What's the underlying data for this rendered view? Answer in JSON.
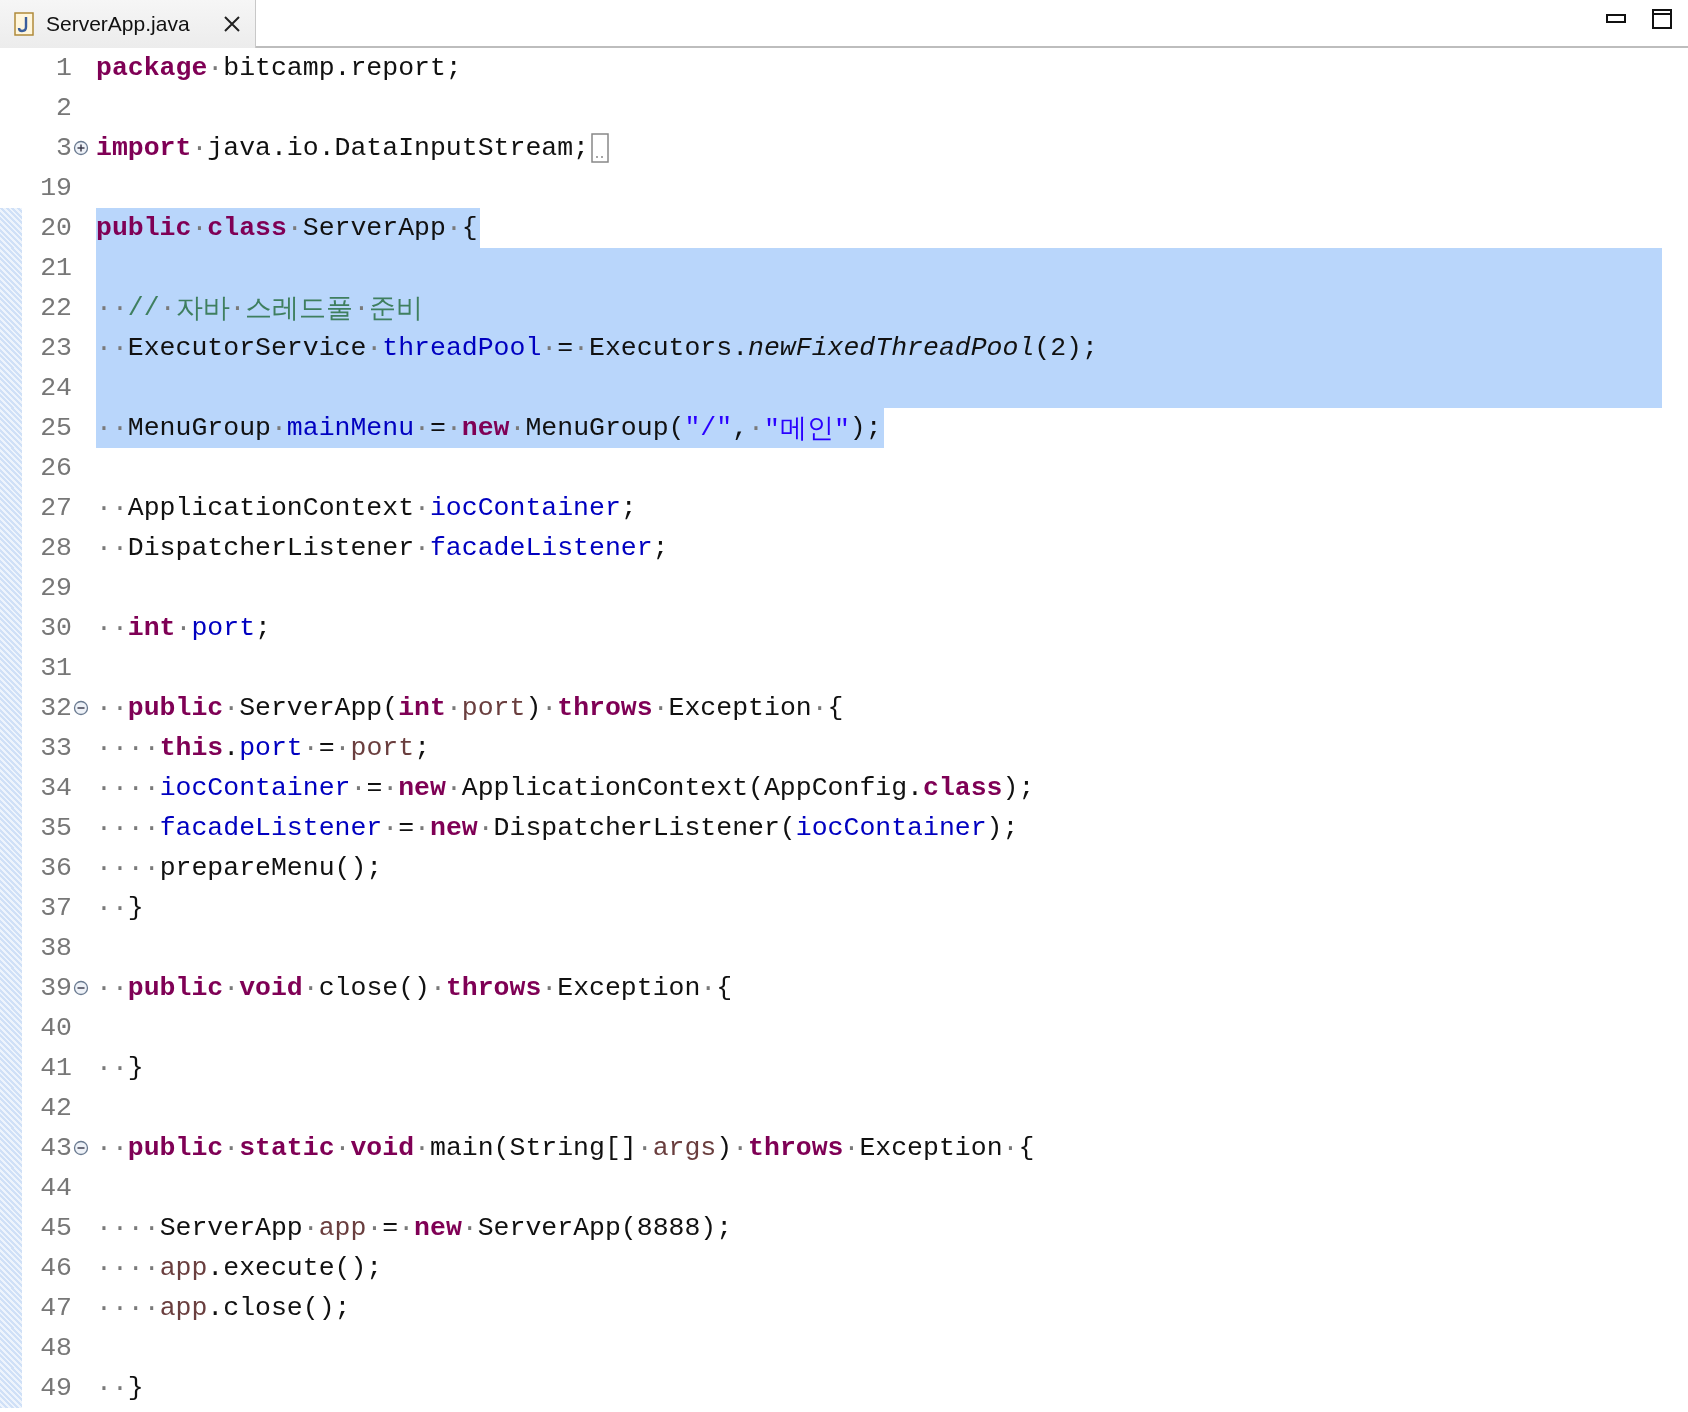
{
  "editor_tab": {
    "title": "ServerApp.java",
    "selected": true
  },
  "lines": [
    {
      "number": "1",
      "in_range": false,
      "tokens": [
        {
          "kind": "keyword",
          "text": "package"
        },
        {
          "kind": "space",
          "text": "·"
        },
        {
          "kind": "plain",
          "text": "bitcamp.report;"
        }
      ]
    },
    {
      "number": "2",
      "in_range": false
    },
    {
      "number": "3",
      "in_range": false,
      "collapsed": true,
      "tokens": [
        {
          "kind": "keyword",
          "text": "import"
        },
        {
          "kind": "space",
          "text": "·"
        },
        {
          "kind": "plain",
          "text": "java.io.DataInputStream;"
        }
      ]
    },
    {
      "number": "19",
      "in_range": false
    },
    {
      "number": "20",
      "in_range": true,
      "selected": true,
      "full_width": false,
      "tokens": [
        {
          "kind": "keyword",
          "text": "public"
        },
        {
          "kind": "space",
          "text": "·"
        },
        {
          "kind": "keyword",
          "text": "class"
        },
        {
          "kind": "space",
          "text": "·"
        },
        {
          "kind": "plain",
          "text": "ServerApp"
        },
        {
          "kind": "space",
          "text": "·"
        },
        {
          "kind": "plain",
          "text": "{"
        }
      ]
    },
    {
      "number": "21",
      "in_range": true,
      "selected": true,
      "full_width": true
    },
    {
      "number": "22",
      "in_range": true,
      "selected": true,
      "full_width": true,
      "tokens": [
        {
          "kind": "space",
          "text": "··"
        },
        {
          "kind": "comment",
          "text": "//"
        },
        {
          "kind": "space",
          "text": "·"
        },
        {
          "kind": "comment",
          "text": "자바"
        },
        {
          "kind": "space",
          "text": "·"
        },
        {
          "kind": "comment",
          "text": "스레드풀"
        },
        {
          "kind": "space",
          "text": "·"
        },
        {
          "kind": "comment",
          "text": "준비"
        }
      ]
    },
    {
      "number": "23",
      "in_range": true,
      "selected": true,
      "full_width": true,
      "tokens": [
        {
          "kind": "space",
          "text": "··"
        },
        {
          "kind": "plain",
          "text": "ExecutorService"
        },
        {
          "kind": "space",
          "text": "·"
        },
        {
          "kind": "field",
          "text": "threadPool"
        },
        {
          "kind": "space",
          "text": "·"
        },
        {
          "kind": "plain",
          "text": "="
        },
        {
          "kind": "space",
          "text": "·"
        },
        {
          "kind": "plain",
          "text": "Executors."
        },
        {
          "kind": "static-method",
          "text": "newFixedThreadPool"
        },
        {
          "kind": "plain",
          "text": "(2);"
        }
      ]
    },
    {
      "number": "24",
      "in_range": true,
      "selected": true,
      "full_width": true
    },
    {
      "number": "25",
      "in_range": true,
      "selected": true,
      "full_width": false,
      "tokens": [
        {
          "kind": "space",
          "text": "··"
        },
        {
          "kind": "plain",
          "text": "MenuGroup"
        },
        {
          "kind": "space",
          "text": "·"
        },
        {
          "kind": "field",
          "text": "mainMenu"
        },
        {
          "kind": "space",
          "text": "·"
        },
        {
          "kind": "plain",
          "text": "="
        },
        {
          "kind": "space",
          "text": "·"
        },
        {
          "kind": "keyword",
          "text": "new"
        },
        {
          "kind": "space",
          "text": "·"
        },
        {
          "kind": "plain",
          "text": "MenuGroup("
        },
        {
          "kind": "string",
          "text": "\"/\""
        },
        {
          "kind": "plain",
          "text": ","
        },
        {
          "kind": "space",
          "text": "·"
        },
        {
          "kind": "string",
          "text": "\"메인\""
        },
        {
          "kind": "plain",
          "text": ");"
        }
      ]
    },
    {
      "number": "26",
      "in_range": true
    },
    {
      "number": "27",
      "in_range": true,
      "tokens": [
        {
          "kind": "space",
          "text": "··"
        },
        {
          "kind": "plain",
          "text": "ApplicationContext"
        },
        {
          "kind": "space",
          "text": "·"
        },
        {
          "kind": "field",
          "text": "iocContainer"
        },
        {
          "kind": "plain",
          "text": ";"
        }
      ]
    },
    {
      "number": "28",
      "in_range": true,
      "tokens": [
        {
          "kind": "space",
          "text": "··"
        },
        {
          "kind": "plain",
          "text": "DispatcherListener"
        },
        {
          "kind": "space",
          "text": "·"
        },
        {
          "kind": "field",
          "text": "facadeListener"
        },
        {
          "kind": "plain",
          "text": ";"
        }
      ]
    },
    {
      "number": "29",
      "in_range": true
    },
    {
      "number": "30",
      "in_range": true,
      "tokens": [
        {
          "kind": "space",
          "text": "··"
        },
        {
          "kind": "keyword",
          "text": "int"
        },
        {
          "kind": "space",
          "text": "·"
        },
        {
          "kind": "field",
          "text": "port"
        },
        {
          "kind": "plain",
          "text": ";"
        }
      ]
    },
    {
      "number": "31",
      "in_range": true
    },
    {
      "number": "32",
      "in_range": true,
      "collapsed": false,
      "tokens": [
        {
          "kind": "space",
          "text": "··"
        },
        {
          "kind": "keyword",
          "text": "public"
        },
        {
          "kind": "space",
          "text": "·"
        },
        {
          "kind": "plain",
          "text": "ServerApp("
        },
        {
          "kind": "keyword",
          "text": "int"
        },
        {
          "kind": "space",
          "text": "·"
        },
        {
          "kind": "local",
          "text": "port"
        },
        {
          "kind": "plain",
          "text": ")"
        },
        {
          "kind": "space",
          "text": "·"
        },
        {
          "kind": "keyword",
          "text": "throws"
        },
        {
          "kind": "space",
          "text": "·"
        },
        {
          "kind": "plain",
          "text": "Exception"
        },
        {
          "kind": "space",
          "text": "·"
        },
        {
          "kind": "plain",
          "text": "{"
        }
      ]
    },
    {
      "number": "33",
      "in_range": true,
      "tokens": [
        {
          "kind": "space",
          "text": "····"
        },
        {
          "kind": "keyword",
          "text": "this"
        },
        {
          "kind": "plain",
          "text": "."
        },
        {
          "kind": "field",
          "text": "port"
        },
        {
          "kind": "space",
          "text": "·"
        },
        {
          "kind": "plain",
          "text": "="
        },
        {
          "kind": "space",
          "text": "·"
        },
        {
          "kind": "local",
          "text": "port"
        },
        {
          "kind": "plain",
          "text": ";"
        }
      ]
    },
    {
      "number": "34",
      "in_range": true,
      "tokens": [
        {
          "kind": "space",
          "text": "····"
        },
        {
          "kind": "field",
          "text": "iocContainer"
        },
        {
          "kind": "space",
          "text": "·"
        },
        {
          "kind": "plain",
          "text": "="
        },
        {
          "kind": "space",
          "text": "·"
        },
        {
          "kind": "keyword",
          "text": "new"
        },
        {
          "kind": "space",
          "text": "·"
        },
        {
          "kind": "plain",
          "text": "ApplicationContext(AppConfig."
        },
        {
          "kind": "keyword",
          "text": "class"
        },
        {
          "kind": "plain",
          "text": ");"
        }
      ]
    },
    {
      "number": "35",
      "in_range": true,
      "tokens": [
        {
          "kind": "space",
          "text": "····"
        },
        {
          "kind": "field",
          "text": "facadeListener"
        },
        {
          "kind": "space",
          "text": "·"
        },
        {
          "kind": "plain",
          "text": "="
        },
        {
          "kind": "space",
          "text": "·"
        },
        {
          "kind": "keyword",
          "text": "new"
        },
        {
          "kind": "space",
          "text": "·"
        },
        {
          "kind": "plain",
          "text": "DispatcherListener("
        },
        {
          "kind": "field",
          "text": "iocContainer"
        },
        {
          "kind": "plain",
          "text": ");"
        }
      ]
    },
    {
      "number": "36",
      "in_range": true,
      "tokens": [
        {
          "kind": "space",
          "text": "····"
        },
        {
          "kind": "plain",
          "text": "prepareMenu();"
        }
      ]
    },
    {
      "number": "37",
      "in_range": true,
      "tokens": [
        {
          "kind": "space",
          "text": "··"
        },
        {
          "kind": "plain",
          "text": "}"
        }
      ]
    },
    {
      "number": "38",
      "in_range": true
    },
    {
      "number": "39",
      "in_range": true,
      "collapsed": false,
      "tokens": [
        {
          "kind": "space",
          "text": "··"
        },
        {
          "kind": "keyword",
          "text": "public"
        },
        {
          "kind": "space",
          "text": "·"
        },
        {
          "kind": "keyword",
          "text": "void"
        },
        {
          "kind": "space",
          "text": "·"
        },
        {
          "kind": "plain",
          "text": "close()"
        },
        {
          "kind": "space",
          "text": "·"
        },
        {
          "kind": "keyword",
          "text": "throws"
        },
        {
          "kind": "space",
          "text": "·"
        },
        {
          "kind": "plain",
          "text": "Exception"
        },
        {
          "kind": "space",
          "text": "·"
        },
        {
          "kind": "plain",
          "text": "{"
        }
      ]
    },
    {
      "number": "40",
      "in_range": true
    },
    {
      "number": "41",
      "in_range": true,
      "tokens": [
        {
          "kind": "space",
          "text": "··"
        },
        {
          "kind": "plain",
          "text": "}"
        }
      ]
    },
    {
      "number": "42",
      "in_range": true
    },
    {
      "number": "43",
      "in_range": true,
      "collapsed": false,
      "tokens": [
        {
          "kind": "space",
          "text": "··"
        },
        {
          "kind": "keyword",
          "text": "public"
        },
        {
          "kind": "space",
          "text": "·"
        },
        {
          "kind": "keyword",
          "text": "static"
        },
        {
          "kind": "space",
          "text": "·"
        },
        {
          "kind": "keyword",
          "text": "void"
        },
        {
          "kind": "space",
          "text": "·"
        },
        {
          "kind": "plain",
          "text": "main(String[]"
        },
        {
          "kind": "space",
          "text": "·"
        },
        {
          "kind": "local",
          "text": "args"
        },
        {
          "kind": "plain",
          "text": ")"
        },
        {
          "kind": "space",
          "text": "·"
        },
        {
          "kind": "keyword",
          "text": "throws"
        },
        {
          "kind": "space",
          "text": "·"
        },
        {
          "kind": "plain",
          "text": "Exception"
        },
        {
          "kind": "space",
          "text": "·"
        },
        {
          "kind": "plain",
          "text": "{"
        }
      ]
    },
    {
      "number": "44",
      "in_range": true
    },
    {
      "number": "45",
      "in_range": true,
      "tokens": [
        {
          "kind": "space",
          "text": "····"
        },
        {
          "kind": "plain",
          "text": "ServerApp"
        },
        {
          "kind": "space",
          "text": "·"
        },
        {
          "kind": "local",
          "text": "app"
        },
        {
          "kind": "space",
          "text": "·"
        },
        {
          "kind": "plain",
          "text": "="
        },
        {
          "kind": "space",
          "text": "·"
        },
        {
          "kind": "keyword",
          "text": "new"
        },
        {
          "kind": "space",
          "text": "·"
        },
        {
          "kind": "plain",
          "text": "ServerApp(8888);"
        }
      ]
    },
    {
      "number": "46",
      "in_range": true,
      "tokens": [
        {
          "kind": "space",
          "text": "····"
        },
        {
          "kind": "local",
          "text": "app"
        },
        {
          "kind": "plain",
          "text": ".execute();"
        }
      ]
    },
    {
      "number": "47",
      "in_range": true,
      "tokens": [
        {
          "kind": "space",
          "text": "····"
        },
        {
          "kind": "local",
          "text": "app"
        },
        {
          "kind": "plain",
          "text": ".close();"
        }
      ]
    },
    {
      "number": "48",
      "in_range": true
    },
    {
      "number": "49",
      "in_range": true,
      "tokens": [
        {
          "kind": "space",
          "text": "··"
        },
        {
          "kind": "plain",
          "text": "}"
        }
      ]
    }
  ]
}
